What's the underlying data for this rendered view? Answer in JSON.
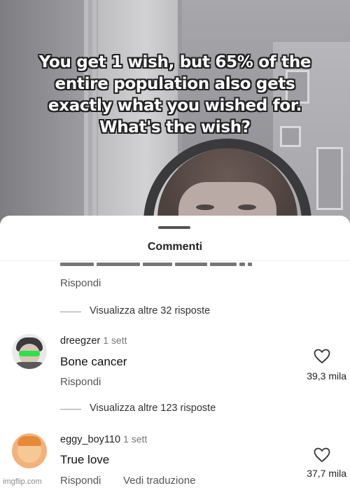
{
  "caption": {
    "lines": [
      "You get 1 wish, but 65% of the",
      "entire population also gets",
      "exactly what you wished for.",
      "What's the wish?"
    ]
  },
  "sheet": {
    "title": "Commenti"
  },
  "thread": {
    "top_reply_label": "Rispondi",
    "view_more_1": "Visualizza altre 32 risposte",
    "view_more_2": "Visualizza altre 123 risposte"
  },
  "comments": [
    {
      "username": "dreegzer",
      "time": "1 sett",
      "text": "Bone cancer",
      "reply_label": "Rispondi",
      "likes": "39,3 mila",
      "avatar_icon": "avatar-green-glasses"
    },
    {
      "username": "eggy_boy110",
      "time": "1 sett",
      "text": "True love",
      "reply_label": "Rispondi",
      "translate_label": "Vedi traduzione",
      "likes": "37,7 mila",
      "avatar_icon": "avatar-baby-face"
    }
  ],
  "watermark": "imgflip.com",
  "colors": {
    "caption_fill": "#ffffff",
    "caption_outline": "#222222",
    "sheet_bg": "#ffffff",
    "muted_text": "#555555"
  }
}
